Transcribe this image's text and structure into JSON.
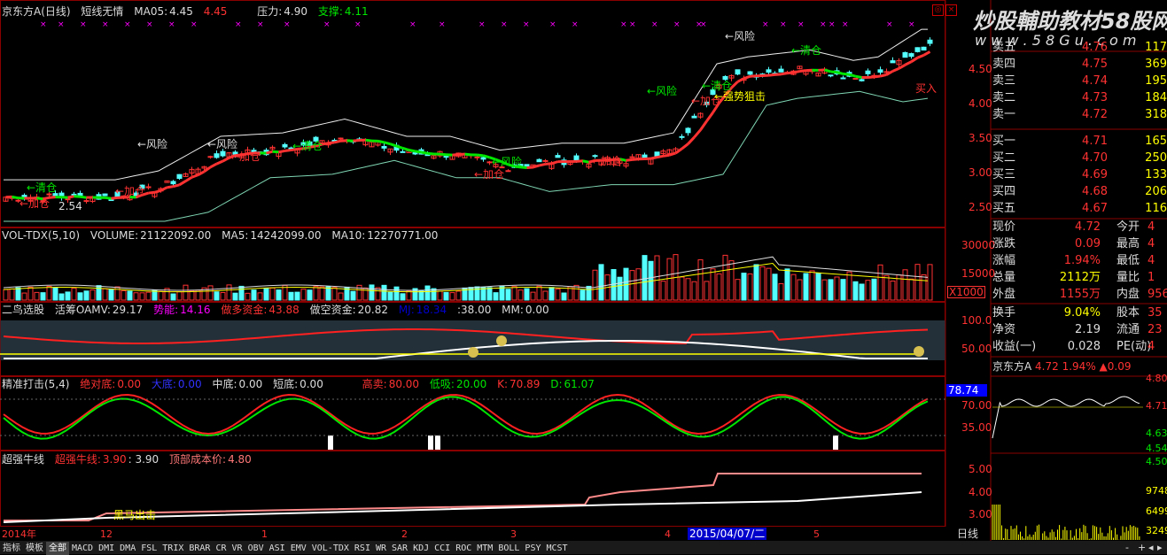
{
  "main_chart": {
    "stock_name": "京东方A",
    "period": "(日线)",
    "indicator_name": "短线无情",
    "ma05_label": "MA05:",
    "ma05_value": "4.45",
    "ma05_value2": "4.45",
    "pressure_label": "压力:",
    "pressure_value": "4.90",
    "support_label": "支撑:",
    "support_value": "4.11",
    "y_ticks": [
      "4.50",
      "4.00",
      "3.50",
      "3.00",
      "2.50"
    ],
    "annotations": {
      "risk": "←风险",
      "clear": "←清仓",
      "add": "←加仓",
      "strong_block": "←强势狙击",
      "buy": "买入",
      "low_price": "2.54"
    }
  },
  "watermark": {
    "text": "炒股輔助教材58股网",
    "url": "w w w . 5 8 G u . c o m"
  },
  "volume_panel": {
    "title": "VOL-TDX(5,10)",
    "volume_label": "VOLUME:",
    "volume_value": "21122092.00",
    "ma5_label": "MA5:",
    "ma5_value": "14242099.00",
    "ma10_label": "MA10:",
    "ma10_value": "12270771.00",
    "y_ticks": [
      "30000",
      "15000"
    ],
    "unit": "X1000"
  },
  "bird_panel": {
    "title": "二鸟选股",
    "amv_label": "活筹OAMV:",
    "amv_value": "29.17",
    "power_label": "势能:",
    "power_value": "14.16",
    "long_label": "做多资金:",
    "long_value": "43.88",
    "short_label": "做空资金:",
    "short_value": "20.82",
    "hidden_label": "MJ:",
    "hidden_value": "18.34",
    "extra_value": ":38.00",
    "mm_label": "MM:",
    "mm_value": "0.00",
    "y_ticks": [
      "100.0",
      "50.00"
    ]
  },
  "precise_panel": {
    "title": "精准打击(5,4)",
    "abs_bottom_label": "绝对底:",
    "abs_bottom_value": "0.00",
    "big_bottom_label": "大底:",
    "big_bottom_value": "0.00",
    "mid_bottom_label": "中底:",
    "mid_bottom_value": "0.00",
    "short_bottom_label": "短底:",
    "short_bottom_value": "0.00",
    "high_sell_label": "高卖:",
    "high_sell_value": "80.00",
    "low_buy_label": "低吸:",
    "low_buy_value": "20.00",
    "k_label": "K:",
    "k_value": "70.89",
    "d_label": "D:",
    "d_value": "61.07",
    "y_ticks": [
      "70.00",
      "35.00"
    ],
    "current_value": "78.74"
  },
  "bull_panel": {
    "title": "超强牛线",
    "bull_line_label": "超强牛线:",
    "bull_line_value": "3.90",
    "bull_line_value2": ": 3.90",
    "top_cost_label": "顶部成本价:",
    "top_cost_value": "4.80",
    "horse_label": "黑马出击",
    "y_ticks": [
      "5.00",
      "4.00",
      "3.00"
    ]
  },
  "x_axis": {
    "labels": [
      "2014年",
      "12",
      "1",
      "2",
      "3",
      "4",
      "5"
    ],
    "cursor_date": "2015/04/07/二"
  },
  "order_book": {
    "sell": [
      {
        "label": "卖五",
        "price": "4.76",
        "vol": "117"
      },
      {
        "label": "卖四",
        "price": "4.75",
        "vol": "369"
      },
      {
        "label": "卖三",
        "price": "4.74",
        "vol": "195"
      },
      {
        "label": "卖二",
        "price": "4.73",
        "vol": "184"
      },
      {
        "label": "卖一",
        "price": "4.72",
        "vol": "318"
      }
    ],
    "buy": [
      {
        "label": "买一",
        "price": "4.71",
        "vol": "165"
      },
      {
        "label": "买二",
        "price": "4.70",
        "vol": "250"
      },
      {
        "label": "买三",
        "price": "4.69",
        "vol": "133"
      },
      {
        "label": "买四",
        "price": "4.68",
        "vol": "206"
      },
      {
        "label": "买五",
        "price": "4.67",
        "vol": "116"
      }
    ]
  },
  "quote_info": {
    "rows": [
      {
        "l1": "现价",
        "v1": "4.72",
        "l2": "今开",
        "v2": "4"
      },
      {
        "l1": "涨跌",
        "v1": "0.09",
        "l2": "最高",
        "v2": "4"
      },
      {
        "l1": "涨幅",
        "v1": "1.94%",
        "l2": "最低",
        "v2": "4"
      },
      {
        "l1": "总量",
        "v1": "2112万",
        "l2": "量比",
        "v2": "1"
      },
      {
        "l1": "外盘",
        "v1": "1155万",
        "l2": "内盘",
        "v2": "956."
      }
    ],
    "rows2": [
      {
        "l1": "换手",
        "v1": "9.04%",
        "l2": "股本",
        "v2": "35"
      },
      {
        "l1": "净资",
        "v1": "2.19",
        "l2": "流通",
        "v2": "23"
      },
      {
        "l1": "收益(一)",
        "v1": "0.028",
        "l2": "PE(动)",
        "v2": "4"
      }
    ]
  },
  "mini_chart": {
    "name": "京东方A",
    "price": "4.72",
    "pct": "1.94%",
    "change": "▲0.09",
    "y_ticks": [
      "4.80",
      "4.71",
      "4.63",
      "4.54",
      "4.50"
    ],
    "vol_ticks": [
      "9748",
      "6499",
      "3249"
    ],
    "period_label": "日线"
  },
  "tabs": [
    "指标",
    "模板",
    "全部",
    "MACD",
    "DMI",
    "DMA",
    "FSL",
    "TRIX",
    "BRAR",
    "CR",
    "VR",
    "OBV",
    "ASI",
    "EMV",
    "VOL-TDX",
    "RSI",
    "WR",
    "SAR",
    "KDJ",
    "CCI",
    "ROC",
    "MTM",
    "BOLL",
    "PSY",
    "MCST"
  ],
  "colors": {
    "up": "#ff3232",
    "down": "#54ffff",
    "yellow": "#ffff00",
    "magenta": "#ff00ff",
    "green": "#00e600"
  }
}
